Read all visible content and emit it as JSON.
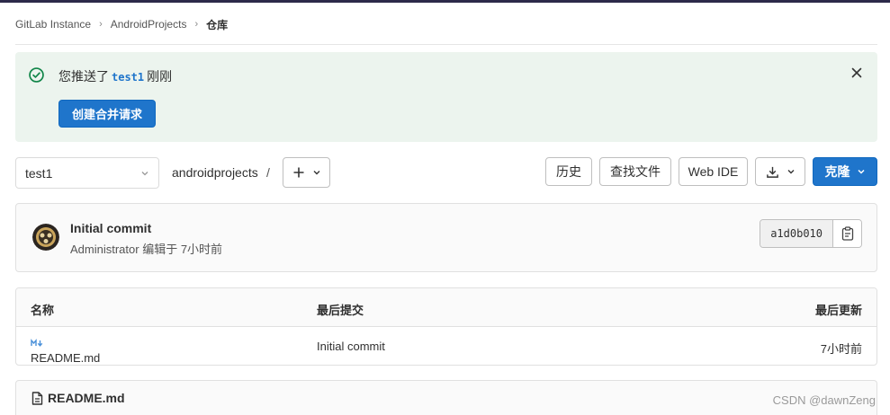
{
  "breadcrumb": {
    "items": [
      "GitLab Instance",
      "AndroidProjects"
    ],
    "current": "仓库"
  },
  "alert": {
    "message_prefix": "您推送了",
    "branch": "test1",
    "message_suffix": "刚刚",
    "action_label": "创建合并请求",
    "icon": "check-circle-icon",
    "close_icon": "close-icon"
  },
  "toolbar": {
    "branch": "test1",
    "path": "androidprojects",
    "path_sep": "/",
    "add_symbol": "+",
    "history": "历史",
    "find_file": "查找文件",
    "web_ide": "Web IDE",
    "clone": "克隆"
  },
  "commit": {
    "title": "Initial commit",
    "author": "Administrator",
    "meta": "编辑于 7小时前",
    "sha": "a1d0b010"
  },
  "files": {
    "headers": [
      "名称",
      "最后提交",
      "最后更新"
    ],
    "rows": [
      {
        "name": "README.md",
        "last_commit": "Initial commit",
        "updated": "7小时前"
      }
    ]
  },
  "readme": {
    "title": "README.md"
  },
  "watermark": "CSDN @dawnZeng",
  "colors": {
    "accent": "#1f75cb",
    "success_bg": "#ecf4ee",
    "success": "#108548"
  }
}
